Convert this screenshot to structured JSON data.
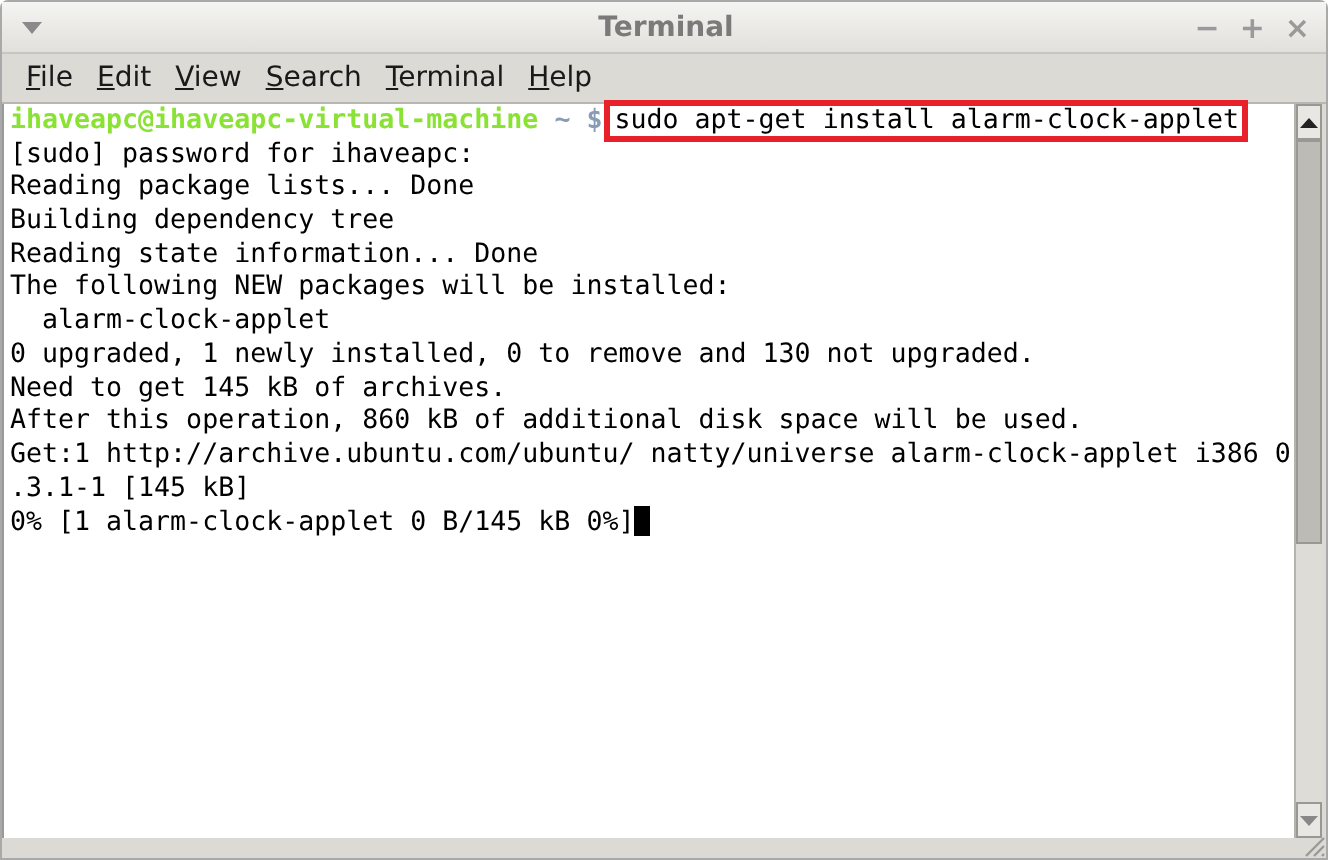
{
  "window": {
    "title": "Terminal",
    "controls": [
      "−",
      "+",
      "×"
    ]
  },
  "menu": [
    {
      "label": "File"
    },
    {
      "label": "Edit"
    },
    {
      "label": "View"
    },
    {
      "label": "Search"
    },
    {
      "label": "Terminal"
    },
    {
      "label": "Help"
    }
  ],
  "terminal": {
    "prompt": {
      "user_host": "ihaveapc@ihaveapc-virtual-machine",
      "path": "~",
      "symbol": "$",
      "command": "sudo apt-get install alarm-clock-applet",
      "highlighted": true
    },
    "lines": [
      "[sudo] password for ihaveapc:",
      "Reading package lists... Done",
      "Building dependency tree",
      "Reading state information... Done",
      "The following NEW packages will be installed:",
      "  alarm-clock-applet",
      "0 upgraded, 1 newly installed, 0 to remove and 130 not upgraded.",
      "Need to get 145 kB of archives.",
      "After this operation, 860 kB of additional disk space will be used.",
      "Get:1 http://archive.ubuntu.com/ubuntu/ natty/universe alarm-clock-applet i386 0",
      ".3.1-1 [145 kB]",
      "0% [1 alarm-clock-applet 0 B/145 kB 0%]"
    ],
    "cursor": true
  }
}
